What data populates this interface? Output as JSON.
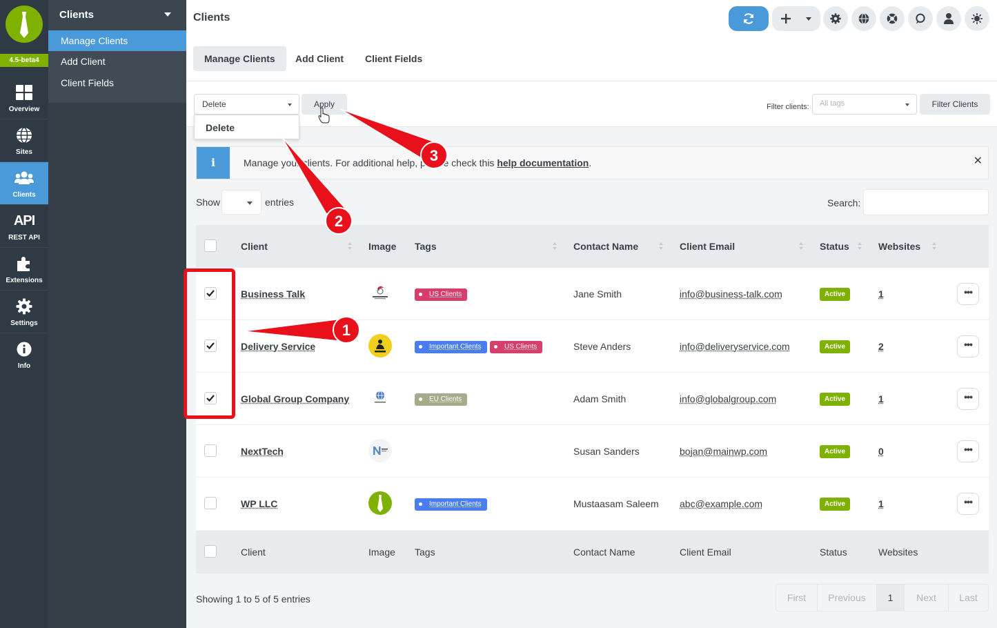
{
  "rail": {
    "version": "4.5-beta4",
    "items": [
      {
        "label": "Overview",
        "icon": "grid-icon"
      },
      {
        "label": "Sites",
        "icon": "globe-icon"
      },
      {
        "label": "Clients",
        "icon": "users-icon"
      },
      {
        "label": "REST API",
        "icon": "api-icon",
        "icon_text": "API"
      },
      {
        "label": "Extensions",
        "icon": "puzzle-icon"
      },
      {
        "label": "Settings",
        "icon": "gear-icon"
      },
      {
        "label": "Info",
        "icon": "info-icon"
      }
    ]
  },
  "submenu": {
    "title": "Clients",
    "items": [
      {
        "label": "Manage Clients"
      },
      {
        "label": "Add Client"
      },
      {
        "label": "Client Fields"
      }
    ]
  },
  "header": {
    "title": "Clients",
    "buttons": [
      "sync-icon",
      "plus-icon",
      "chevron-down-icon",
      "gear-icon",
      "globe-icon",
      "support-icon",
      "chat-icon",
      "user-icon",
      "theme-icon"
    ]
  },
  "tabs": [
    {
      "label": "Manage Clients"
    },
    {
      "label": "Add Client"
    },
    {
      "label": "Client Fields"
    }
  ],
  "bulk": {
    "selected": "Delete",
    "options": [
      "Delete"
    ],
    "apply_label": "Apply"
  },
  "filter": {
    "label": "Filter clients:",
    "placeholder": "All tags",
    "button": "Filter Clients"
  },
  "message": {
    "text_before": "Manage your clients. For additional help, please check this ",
    "link": "help documentation",
    "text_after": ".",
    "close": "✕"
  },
  "table_controls": {
    "show": "Show",
    "entries": "entries",
    "search": "Search:"
  },
  "columns": [
    "Client",
    "Image",
    "Tags",
    "Contact Name",
    "Client Email",
    "Status",
    "Websites"
  ],
  "rows": [
    {
      "name": "Business Talk",
      "checked": true,
      "tags": [
        "US Clients"
      ],
      "contact": "Jane Smith",
      "email": "info@business-talk.com",
      "status": "Active",
      "websites": "1"
    },
    {
      "name": "Delivery Service",
      "checked": true,
      "tags": [
        "Important Clients",
        "US Clients"
      ],
      "contact": "Steve Anders",
      "email": "info@deliveryservice.com",
      "status": "Active",
      "websites": "2"
    },
    {
      "name": "Global Group Company",
      "checked": true,
      "tags": [
        "EU Clients"
      ],
      "contact": "Adam Smith",
      "email": "info@globalgroup.com",
      "status": "Active",
      "websites": "1"
    },
    {
      "name": "NextTech",
      "checked": false,
      "tags": [],
      "contact": "Susan Sanders",
      "email": "bojan@mainwp.com",
      "status": "Active",
      "websites": "0"
    },
    {
      "name": "WP LLC",
      "checked": false,
      "tags": [
        "Important Clients"
      ],
      "contact": "Mustaasam Saleem",
      "email": "abc@example.com",
      "status": "Active",
      "websites": "1"
    }
  ],
  "footer": {
    "showing": "Showing 1 to 5 of 5 entries",
    "pager": [
      "First",
      "Previous",
      "1",
      "Next",
      "Last"
    ]
  },
  "callouts": [
    "1",
    "2",
    "3"
  ],
  "colors": {
    "accent": "#4a9ad9",
    "brand": "#7fb100",
    "annotation": "#e8101a",
    "tag_us": "#d63e6b",
    "tag_important": "#4a7ef0",
    "tag_eu": "#a4ac8c"
  }
}
